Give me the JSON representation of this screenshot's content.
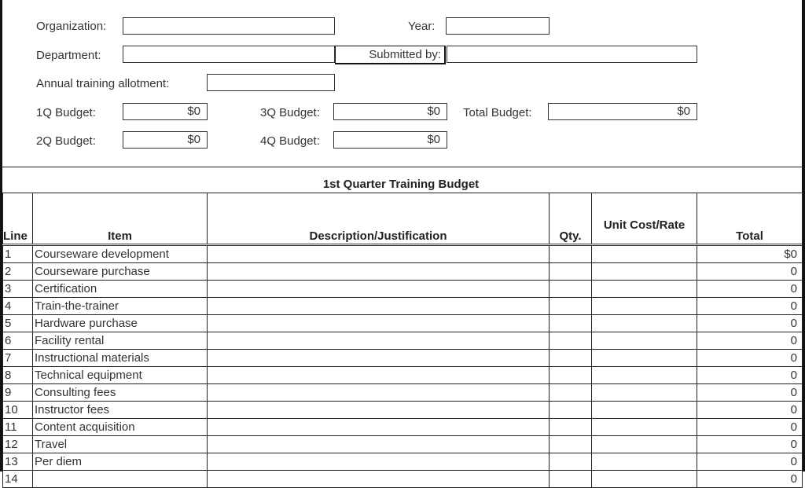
{
  "header": {
    "organization_label": "Organization:",
    "organization_value": "",
    "year_label": "Year:",
    "year_value": "",
    "department_label": "Department:",
    "department_value": "",
    "submitted_by_label": "Submitted by:",
    "submitted_by_value": "",
    "allotment_label": "Annual training allotment:",
    "allotment_value": "",
    "q1_label": "1Q Budget:",
    "q1_value": "$0",
    "q2_label": "2Q Budget:",
    "q2_value": "$0",
    "q3_label": "3Q Budget:",
    "q3_value": "$0",
    "q4_label": "4Q Budget:",
    "q4_value": "$0",
    "total_label": "Total Budget:",
    "total_value": "$0"
  },
  "table": {
    "title": "1st Quarter Training Budget",
    "columns": [
      "Line",
      "Item",
      "Description/Justification",
      "Qty.",
      "Unit Cost/Rate",
      "Total"
    ],
    "rows": [
      {
        "line": "1",
        "item": "Courseware development",
        "desc": "",
        "qty": "",
        "rate": "",
        "total": "$0"
      },
      {
        "line": "2",
        "item": "Courseware purchase",
        "desc": "",
        "qty": "",
        "rate": "",
        "total": "0"
      },
      {
        "line": "3",
        "item": "Certification",
        "desc": "",
        "qty": "",
        "rate": "",
        "total": "0"
      },
      {
        "line": "4",
        "item": "Train-the-trainer",
        "desc": "",
        "qty": "",
        "rate": "",
        "total": "0"
      },
      {
        "line": "5",
        "item": "Hardware purchase",
        "desc": "",
        "qty": "",
        "rate": "",
        "total": "0"
      },
      {
        "line": "6",
        "item": "Facility rental",
        "desc": "",
        "qty": "",
        "rate": "",
        "total": "0"
      },
      {
        "line": "7",
        "item": "Instructional materials",
        "desc": "",
        "qty": "",
        "rate": "",
        "total": "0"
      },
      {
        "line": "8",
        "item": "Technical equipment",
        "desc": "",
        "qty": "",
        "rate": "",
        "total": "0"
      },
      {
        "line": "9",
        "item": "Consulting fees",
        "desc": "",
        "qty": "",
        "rate": "",
        "total": "0"
      },
      {
        "line": "10",
        "item": "Instructor fees",
        "desc": "",
        "qty": "",
        "rate": "",
        "total": "0"
      },
      {
        "line": "11",
        "item": "Content acquisition",
        "desc": "",
        "qty": "",
        "rate": "",
        "total": "0"
      },
      {
        "line": "12",
        "item": "Travel",
        "desc": "",
        "qty": "",
        "rate": "",
        "total": "0"
      },
      {
        "line": "13",
        "item": "Per diem",
        "desc": "",
        "qty": "",
        "rate": "",
        "total": "0"
      },
      {
        "line": "14",
        "item": "",
        "desc": "",
        "qty": "",
        "rate": "",
        "total": "0"
      }
    ]
  }
}
